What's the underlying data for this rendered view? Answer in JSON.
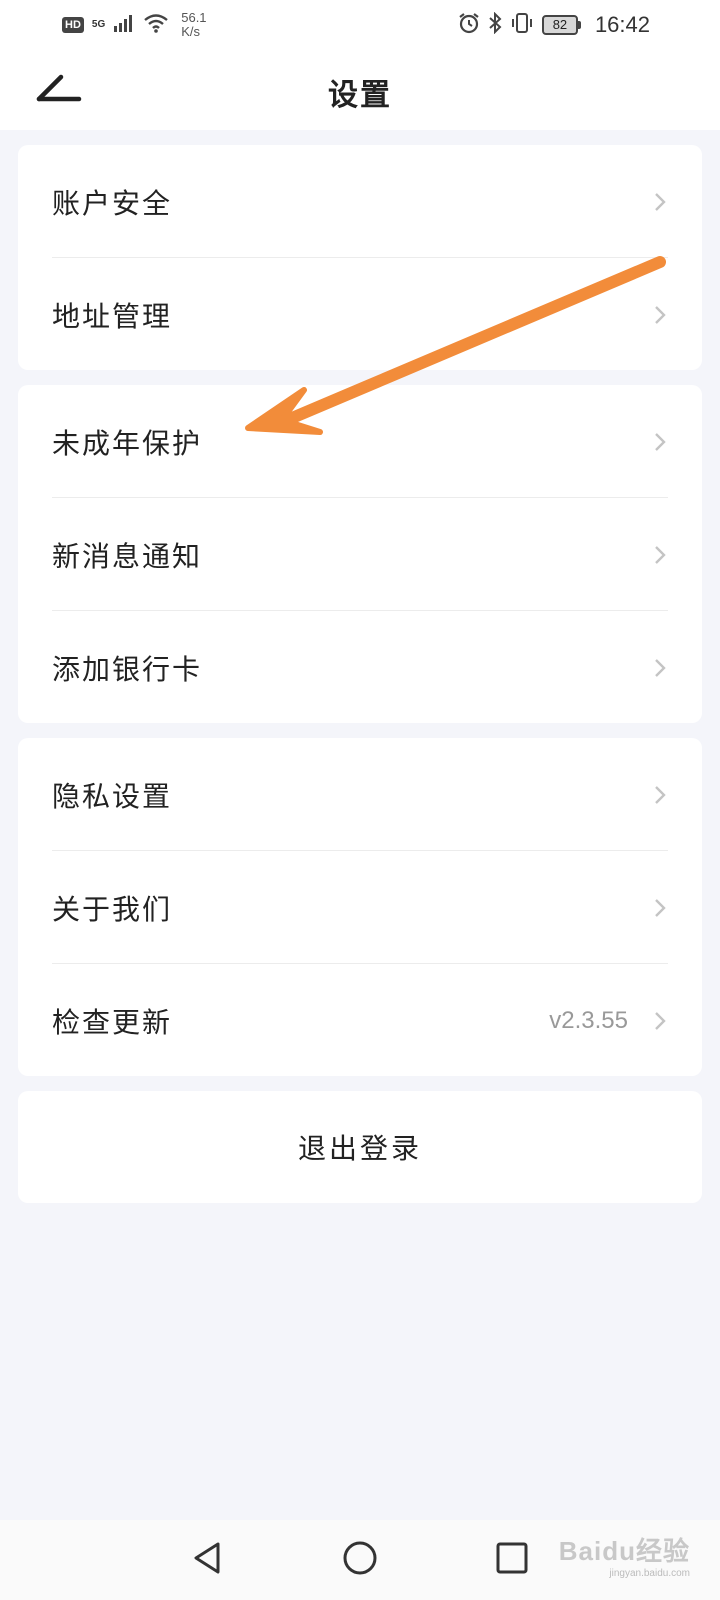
{
  "status_bar": {
    "hd": "HD",
    "network": "5G",
    "speed_value": "56.1",
    "speed_unit": "K/s",
    "battery": "82",
    "time": "16:42"
  },
  "nav": {
    "title": "设置"
  },
  "groups": [
    {
      "items": [
        {
          "label": "账户安全"
        },
        {
          "label": "地址管理"
        }
      ]
    },
    {
      "items": [
        {
          "label": "未成年保护"
        },
        {
          "label": "新消息通知"
        },
        {
          "label": "添加银行卡"
        }
      ]
    },
    {
      "items": [
        {
          "label": "隐私设置"
        },
        {
          "label": "关于我们"
        },
        {
          "label": "检查更新",
          "value": "v2.3.55"
        }
      ]
    }
  ],
  "logout_label": "退出登录",
  "annotation": {
    "color": "#f28c3a"
  },
  "watermark": {
    "main": "Baidu经验",
    "sub": "jingyan.baidu.com"
  }
}
